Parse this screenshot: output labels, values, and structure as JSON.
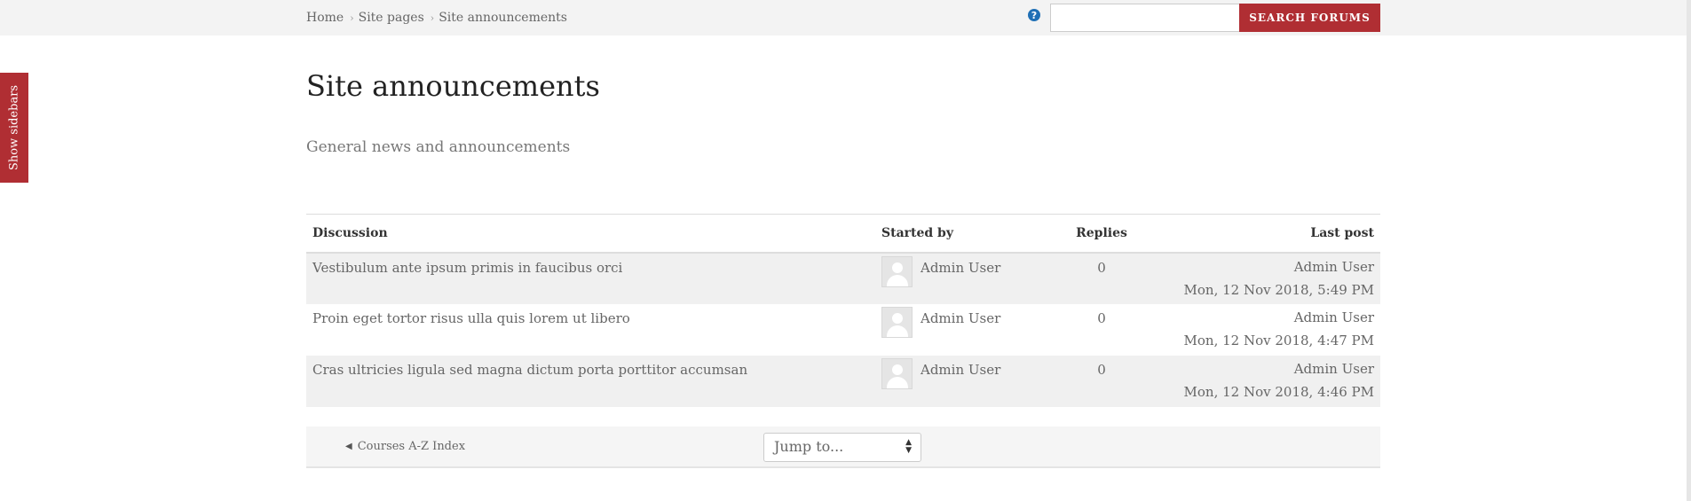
{
  "breadcrumb": {
    "items": [
      {
        "label": "Home"
      },
      {
        "label": "Site pages"
      },
      {
        "label": "Site announcements"
      }
    ],
    "separator": "›"
  },
  "header": {
    "help_icon": "?",
    "search": {
      "value": "",
      "placeholder": ""
    },
    "search_button_label": "SEARCH FORUMS"
  },
  "sidebar": {
    "toggle_label": "Show sidebars"
  },
  "main": {
    "title": "Site announcements",
    "intro": "General news and announcements"
  },
  "table": {
    "headers": {
      "discussion": "Discussion",
      "started_by": "Started by",
      "replies": "Replies",
      "last_post": "Last post"
    },
    "rows": [
      {
        "discussion": "Vestibulum ante ipsum primis in faucibus orci",
        "started_by": "Admin User",
        "replies": "0",
        "last_post_user": "Admin User",
        "last_post_date": "Mon, 12 Nov 2018, 5:49 PM"
      },
      {
        "discussion": "Proin eget tortor risus ulla quis lorem ut libero",
        "started_by": "Admin User",
        "replies": "0",
        "last_post_user": "Admin User",
        "last_post_date": "Mon, 12 Nov 2018, 4:47 PM"
      },
      {
        "discussion": "Cras ultricies ligula sed magna dictum porta porttitor accumsan",
        "started_by": "Admin User",
        "replies": "0",
        "last_post_user": "Admin User",
        "last_post_date": "Mon, 12 Nov 2018, 4:46 PM"
      }
    ]
  },
  "footer_nav": {
    "prev_link_label": "Courses A-Z Index",
    "prev_icon": "◀",
    "jump_select_value": "Jump to...",
    "jump_arrows_icon": "sort-arrows-icon"
  },
  "colors": {
    "accent": "#b02e33",
    "help_icon": "#1f6fb5",
    "row_stripe": "#f0f0f0",
    "navbar_bg": "#f3f3f3"
  }
}
